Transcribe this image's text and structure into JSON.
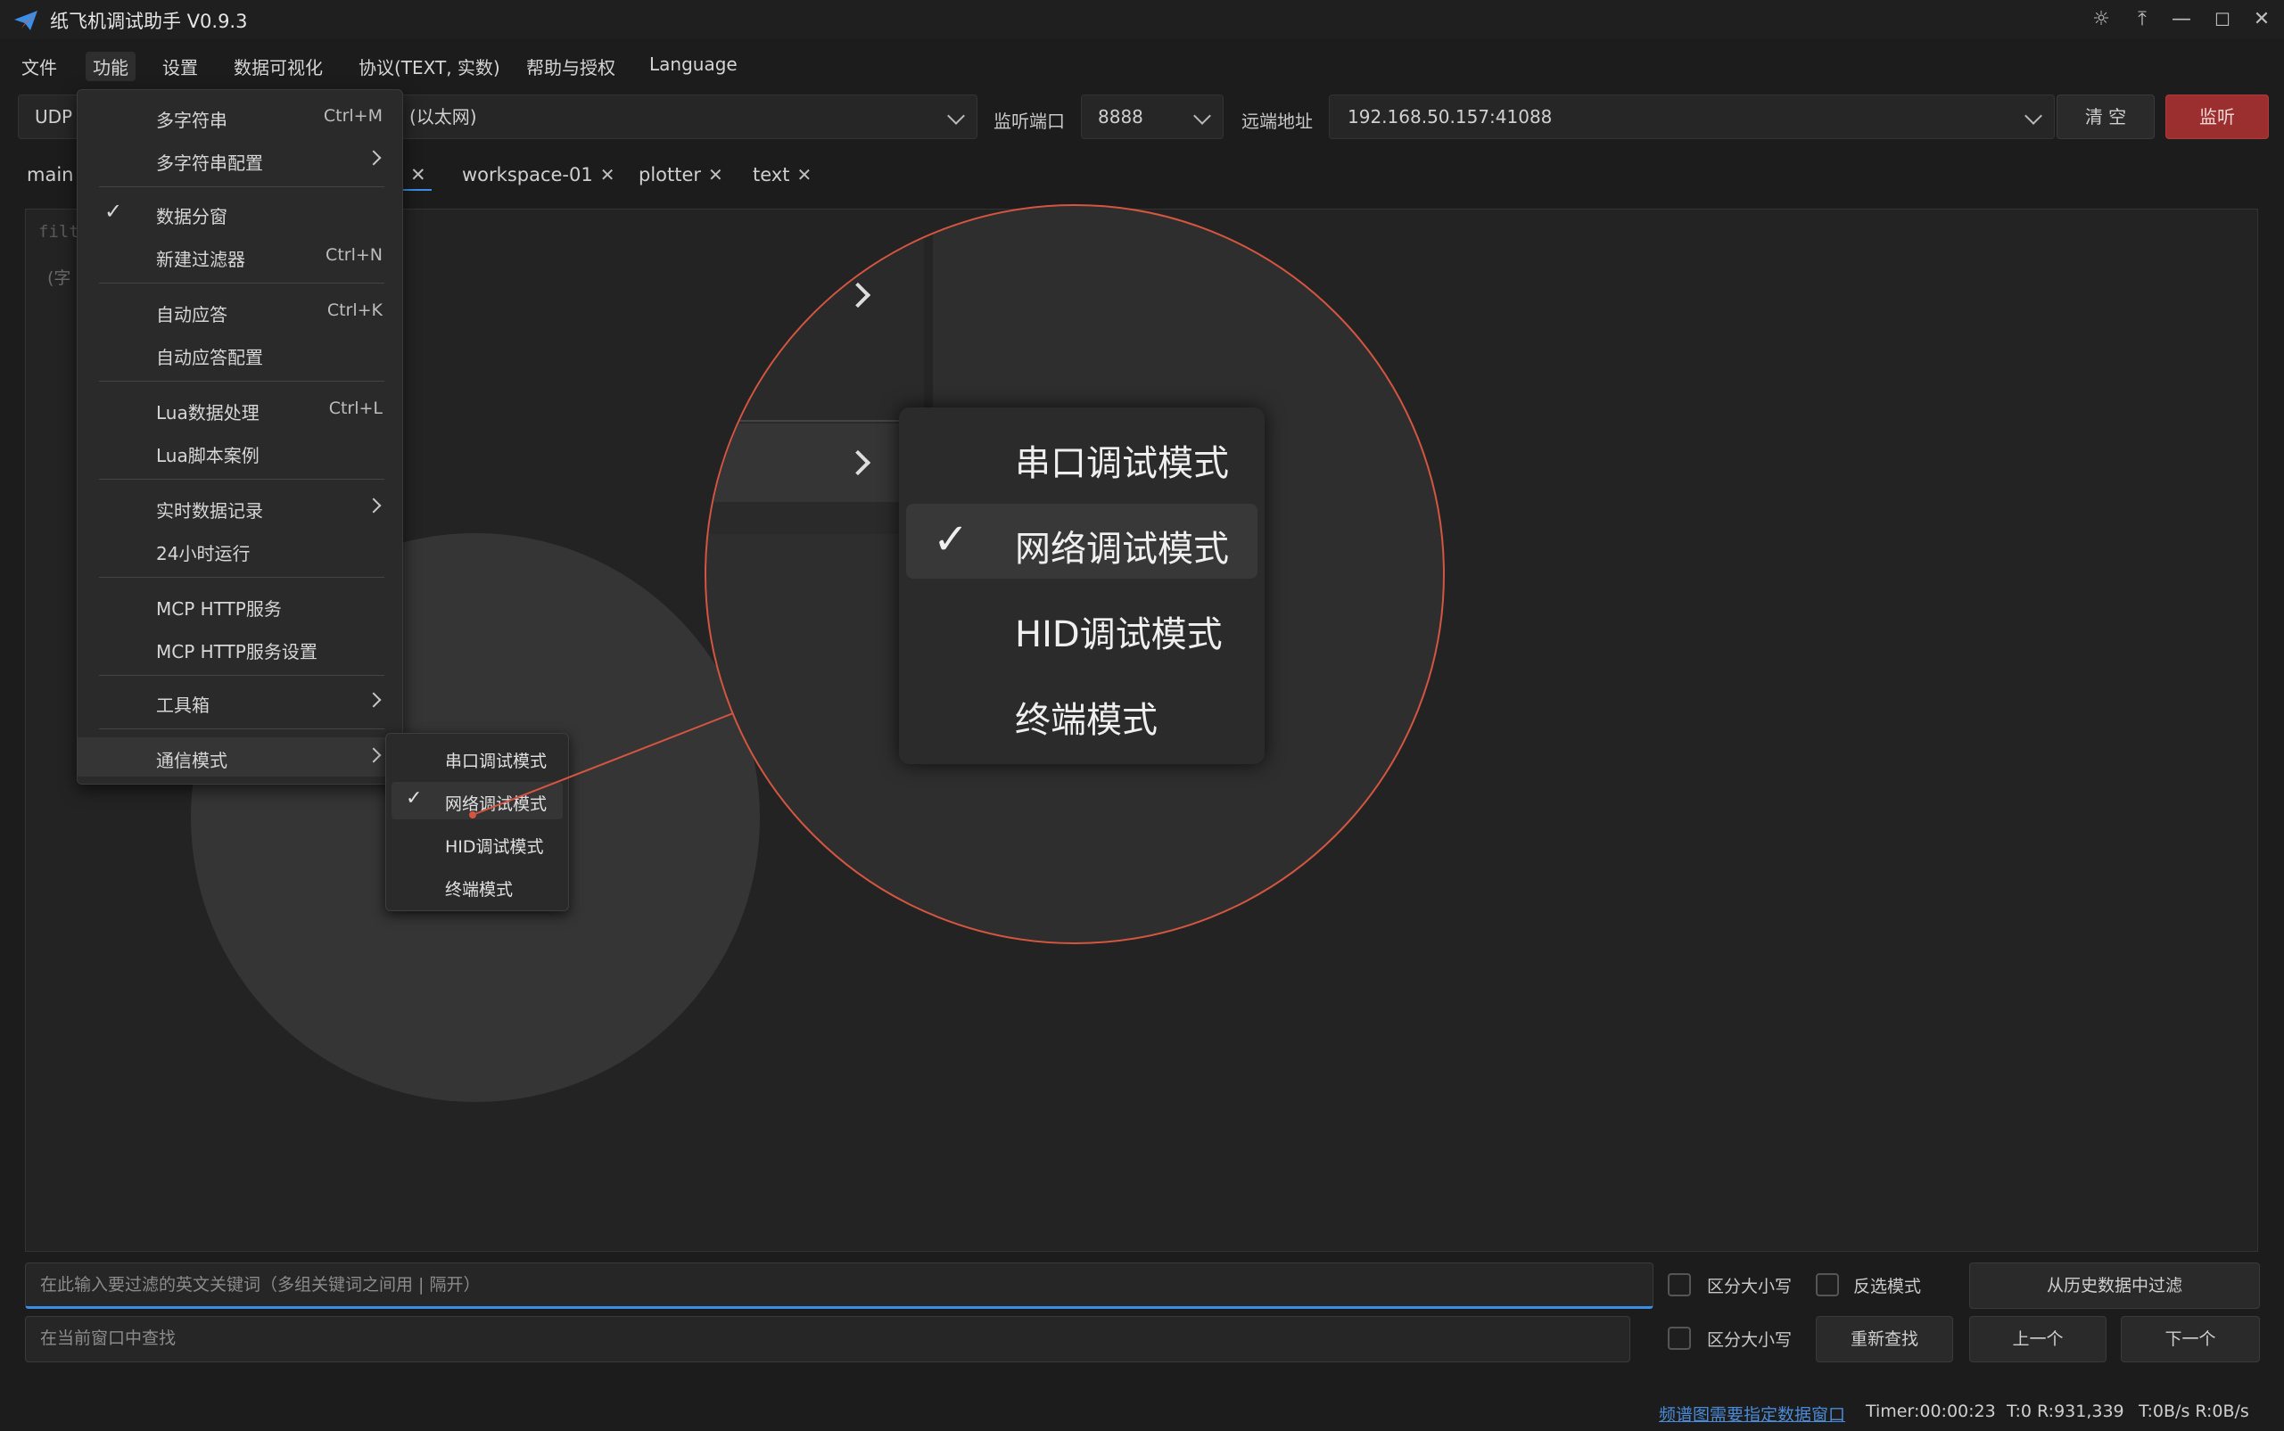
{
  "window": {
    "title": "纸飞机调试助手 V0.9.3",
    "accent_color": "#d45540",
    "listen_button_color": "#9b2f2f"
  },
  "title_controls": [
    "theme-icon",
    "pin-icon",
    "minimize-icon",
    "maximize-icon",
    "close-icon"
  ],
  "menubar": [
    "文件",
    "功能",
    "设置",
    "数据可视化",
    "协议(TEXT, 实数)",
    "帮助与授权",
    "Language"
  ],
  "toolbar": {
    "protocol": "UDP",
    "interface": "(以太网)",
    "port_label": "监听端口",
    "port_value": "8888",
    "remote_label": "远端地址",
    "remote_value": "192.168.50.157:41088",
    "clear_button": "清 空",
    "listen_button": "监听"
  },
  "tabs": [
    "main",
    "workspace-01",
    "plotter",
    "text"
  ],
  "main_panel": {
    "filter_text": "filt",
    "hint_text": "(字"
  },
  "function_menu": {
    "items": [
      {
        "label": "多字符串",
        "shortcut": "Ctrl+M"
      },
      {
        "label": "多字符串配置",
        "submenu": true
      },
      {
        "label": "数据分窗",
        "checked": true
      },
      {
        "label": "新建过滤器",
        "shortcut": "Ctrl+N"
      },
      {
        "label": "自动应答",
        "shortcut": "Ctrl+K"
      },
      {
        "label": "自动应答配置"
      },
      {
        "label": "Lua数据处理",
        "shortcut": "Ctrl+L"
      },
      {
        "label": "Lua脚本案例"
      },
      {
        "label": "实时数据记录",
        "submenu": true
      },
      {
        "label": "24小时运行"
      },
      {
        "label": "MCP HTTP服务"
      },
      {
        "label": "MCP HTTP服务设置"
      },
      {
        "label": "工具箱",
        "submenu": true
      },
      {
        "label": "通信模式",
        "submenu": true,
        "highlighted": true
      }
    ]
  },
  "comm_mode_submenu": {
    "items": [
      {
        "label": "串口调试模式"
      },
      {
        "label": "网络调试模式",
        "checked": true
      },
      {
        "label": "HID调试模式"
      },
      {
        "label": "终端模式"
      }
    ]
  },
  "bottom": {
    "filter_placeholder": "在此输入要过滤的英文关键词（多组关键词之间用 | 隔开）",
    "case_sensitive": "区分大小写",
    "invert_mode": "反选模式",
    "filter_history_button": "从历史数据中过滤",
    "search_placeholder": "在当前窗口中查找",
    "case_sensitive_2": "区分大小写",
    "research_button": "重新查找",
    "prev_button": "上一个",
    "next_button": "下一个"
  },
  "statusbar": {
    "link_text": "频谱图需要指定数据窗口",
    "timer": "Timer:00:00:23",
    "counters": "T:0 R:931,339",
    "rate": "T:0B/s R:0B/s"
  }
}
